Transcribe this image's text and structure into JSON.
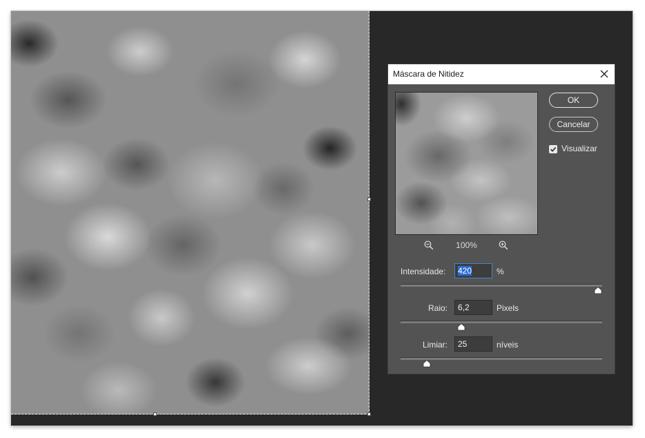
{
  "dialog": {
    "title": "Máscara de Nitidez",
    "ok_label": "OK",
    "cancel_label": "Cancelar",
    "preview_label": "Visualizar",
    "preview_checked": true,
    "zoom_level": "100%",
    "intensity": {
      "label": "Intensidade:",
      "value": "420",
      "unit": "%",
      "slider_fraction": 0.98
    },
    "radius": {
      "label": "Raio:",
      "value": "6,2",
      "unit": "Pixels",
      "slider_fraction": 0.3
    },
    "threshold": {
      "label": "Limiar:",
      "value": "25",
      "unit": "níveis",
      "slider_fraction": 0.13
    }
  },
  "colors": {
    "workspace": "#282828",
    "dialog_bg": "#535353",
    "selection_accent": "#2b6dd6"
  },
  "icons": [
    "close-icon",
    "zoom-out-icon",
    "zoom-in-icon",
    "checkmark-icon",
    "slider-thumb-icon"
  ]
}
